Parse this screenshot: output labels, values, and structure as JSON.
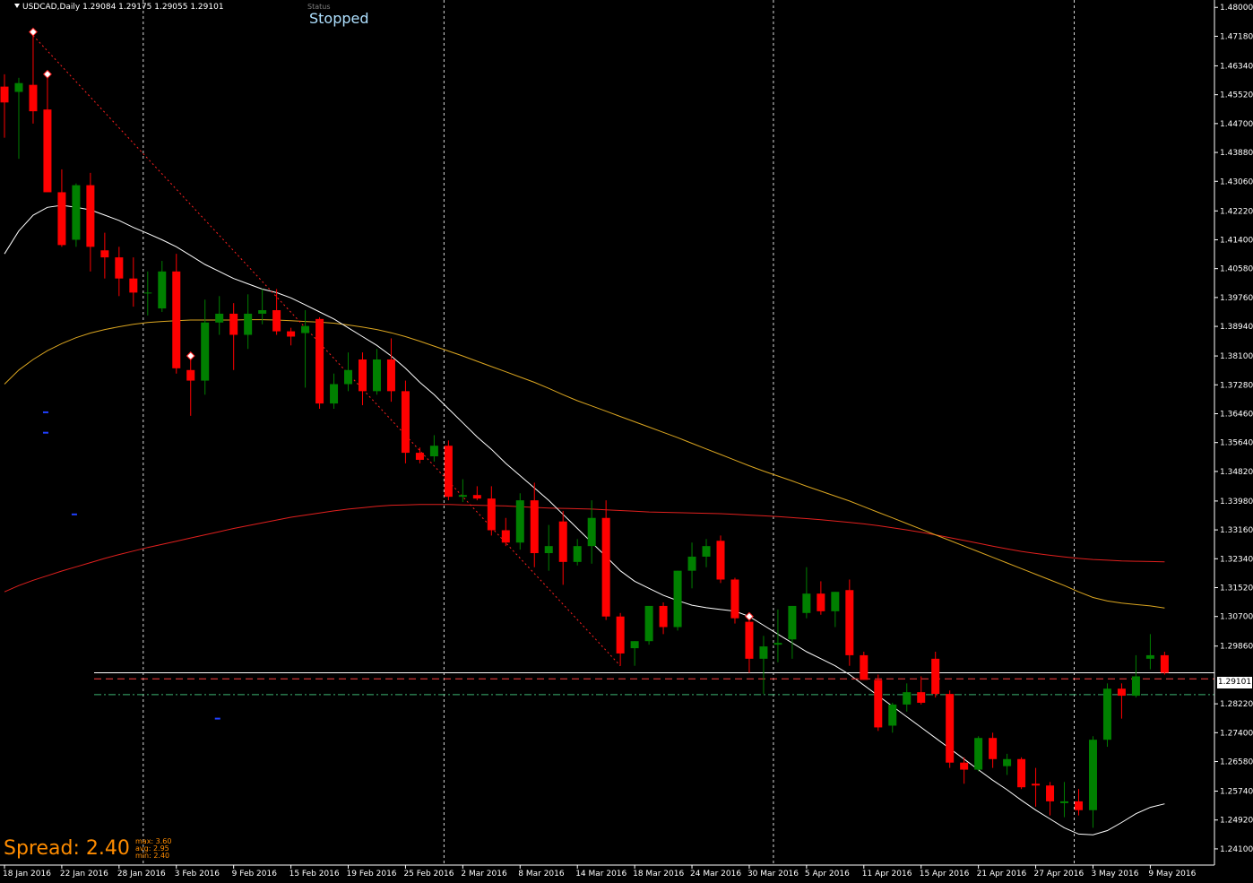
{
  "header": {
    "symbol_info": "USDCAD,Daily  1.29084 1.29175 1.29055 1.29101",
    "status_label": "Status",
    "status_value": "Stopped"
  },
  "spread": {
    "label": "Spread: 2.40",
    "max": "max: 3.60",
    "avg": "avg: 2.95",
    "min": "min: 2.40"
  },
  "colors": {
    "background": "#000000",
    "bull": "#008000",
    "bear": "#ff0000",
    "ma_fast": "#ffffff",
    "ma_mid": "#daa520",
    "ma_slow": "#e0201e",
    "grid": "#ffffff",
    "axis_text": "#ffffff"
  },
  "chart_data": {
    "type": "candlestick",
    "symbol": "USDCAD",
    "timeframe": "Daily",
    "ylim": [
      1.2364,
      1.4821
    ],
    "y_ticks": [
      "1.48000",
      "1.47180",
      "1.46340",
      "1.45520",
      "1.44700",
      "1.43880",
      "1.43060",
      "1.42220",
      "1.41400",
      "1.40580",
      "1.39760",
      "1.38940",
      "1.38100",
      "1.37280",
      "1.36460",
      "1.35640",
      "1.34820",
      "1.33980",
      "1.33160",
      "1.32340",
      "1.31520",
      "1.30700",
      "1.29860",
      "1.28220",
      "1.27400",
      "1.26580",
      "1.25740",
      "1.24920",
      "1.24100"
    ],
    "x_labels": [
      "18 Jan 2016",
      "22 Jan 2016",
      "28 Jan 2016",
      "3 Feb 2016",
      "9 Feb 2016",
      "15 Feb 2016",
      "19 Feb 2016",
      "25 Feb 2016",
      "2 Mar 2016",
      "8 Mar 2016",
      "14 Mar 2016",
      "18 Mar 2016",
      "24 Mar 2016",
      "30 Mar 2016",
      "5 Apr 2016",
      "11 Apr 2016",
      "15 Apr 2016",
      "21 Apr 2016",
      "27 Apr 2016",
      "3 May 2016",
      "9 May 2016"
    ],
    "x_label_index": [
      0,
      4,
      8,
      12,
      16,
      20,
      24,
      28,
      32,
      36,
      40,
      44,
      48,
      52,
      56,
      60,
      64,
      68,
      72,
      76,
      80
    ],
    "period_separators": [
      10,
      31,
      54,
      75
    ],
    "current_price": "1.29101",
    "horizontal_levels": [
      {
        "price": 1.291,
        "style": "solid",
        "color": "#ffffff"
      },
      {
        "price": 1.2893,
        "style": "dashed",
        "color": "#ff4040"
      },
      {
        "price": 1.2848,
        "style": "dashdot",
        "color": "#3cb371"
      }
    ],
    "candles": [
      {
        "o": 1.4575,
        "h": 1.461,
        "l": 1.443,
        "c": 1.453
      },
      {
        "o": 1.456,
        "h": 1.46,
        "l": 1.437,
        "c": 1.4585
      },
      {
        "o": 1.458,
        "h": 1.472,
        "l": 1.447,
        "c": 1.4505
      },
      {
        "o": 1.451,
        "h": 1.46,
        "l": 1.4295,
        "c": 1.4275
      },
      {
        "o": 1.4275,
        "h": 1.434,
        "l": 1.412,
        "c": 1.4125
      },
      {
        "o": 1.414,
        "h": 1.43,
        "l": 1.412,
        "c": 1.4295
      },
      {
        "o": 1.4295,
        "h": 1.433,
        "l": 1.405,
        "c": 1.412
      },
      {
        "o": 1.411,
        "h": 1.416,
        "l": 1.403,
        "c": 1.409
      },
      {
        "o": 1.409,
        "h": 1.412,
        "l": 1.398,
        "c": 1.403
      },
      {
        "o": 1.403,
        "h": 1.409,
        "l": 1.395,
        "c": 1.399
      },
      {
        "o": 1.399,
        "h": 1.405,
        "l": 1.3925,
        "c": 1.399
      },
      {
        "o": 1.3945,
        "h": 1.408,
        "l": 1.3935,
        "c": 1.405
      },
      {
        "o": 1.405,
        "h": 1.41,
        "l": 1.376,
        "c": 1.3775
      },
      {
        "o": 1.377,
        "h": 1.38,
        "l": 1.364,
        "c": 1.374
      },
      {
        "o": 1.374,
        "h": 1.397,
        "l": 1.37,
        "c": 1.3905
      },
      {
        "o": 1.3905,
        "h": 1.398,
        "l": 1.387,
        "c": 1.393
      },
      {
        "o": 1.393,
        "h": 1.396,
        "l": 1.377,
        "c": 1.387
      },
      {
        "o": 1.387,
        "h": 1.3985,
        "l": 1.383,
        "c": 1.393
      },
      {
        "o": 1.393,
        "h": 1.4,
        "l": 1.39,
        "c": 1.394
      },
      {
        "o": 1.394,
        "h": 1.4,
        "l": 1.387,
        "c": 1.388
      },
      {
        "o": 1.388,
        "h": 1.389,
        "l": 1.384,
        "c": 1.3865
      },
      {
        "o": 1.3875,
        "h": 1.394,
        "l": 1.372,
        "c": 1.3895
      },
      {
        "o": 1.3915,
        "h": 1.392,
        "l": 1.366,
        "c": 1.3675
      },
      {
        "o": 1.3675,
        "h": 1.376,
        "l": 1.366,
        "c": 1.373
      },
      {
        "o": 1.373,
        "h": 1.382,
        "l": 1.371,
        "c": 1.377
      },
      {
        "o": 1.38,
        "h": 1.382,
        "l": 1.367,
        "c": 1.371
      },
      {
        "o": 1.371,
        "h": 1.383,
        "l": 1.37,
        "c": 1.38
      },
      {
        "o": 1.38,
        "h": 1.386,
        "l": 1.368,
        "c": 1.371
      },
      {
        "o": 1.371,
        "h": 1.374,
        "l": 1.3505,
        "c": 1.3535
      },
      {
        "o": 1.3535,
        "h": 1.355,
        "l": 1.3505,
        "c": 1.3515
      },
      {
        "o": 1.3525,
        "h": 1.3585,
        "l": 1.351,
        "c": 1.3555
      },
      {
        "o": 1.3555,
        "h": 1.357,
        "l": 1.34,
        "c": 1.341
      },
      {
        "o": 1.341,
        "h": 1.346,
        "l": 1.3395,
        "c": 1.3415
      },
      {
        "o": 1.3415,
        "h": 1.344,
        "l": 1.34,
        "c": 1.3405
      },
      {
        "o": 1.3405,
        "h": 1.344,
        "l": 1.33,
        "c": 1.3315
      },
      {
        "o": 1.3315,
        "h": 1.335,
        "l": 1.327,
        "c": 1.328
      },
      {
        "o": 1.328,
        "h": 1.342,
        "l": 1.326,
        "c": 1.34
      },
      {
        "o": 1.34,
        "h": 1.345,
        "l": 1.321,
        "c": 1.325
      },
      {
        "o": 1.325,
        "h": 1.333,
        "l": 1.32,
        "c": 1.327
      },
      {
        "o": 1.334,
        "h": 1.337,
        "l": 1.316,
        "c": 1.3225
      },
      {
        "o": 1.3225,
        "h": 1.329,
        "l": 1.3215,
        "c": 1.327
      },
      {
        "o": 1.327,
        "h": 1.34,
        "l": 1.322,
        "c": 1.335
      },
      {
        "o": 1.335,
        "h": 1.34,
        "l": 1.306,
        "c": 1.307
      },
      {
        "o": 1.307,
        "h": 1.308,
        "l": 1.293,
        "c": 1.2965
      },
      {
        "o": 1.298,
        "h": 1.3,
        "l": 1.293,
        "c": 1.3
      },
      {
        "o": 1.3,
        "h": 1.31,
        "l": 1.299,
        "c": 1.31
      },
      {
        "o": 1.31,
        "h": 1.311,
        "l": 1.302,
        "c": 1.304
      },
      {
        "o": 1.304,
        "h": 1.32,
        "l": 1.303,
        "c": 1.32
      },
      {
        "o": 1.32,
        "h": 1.328,
        "l": 1.315,
        "c": 1.324
      },
      {
        "o": 1.324,
        "h": 1.329,
        "l": 1.321,
        "c": 1.327
      },
      {
        "o": 1.3285,
        "h": 1.33,
        "l": 1.3165,
        "c": 1.3175
      },
      {
        "o": 1.3175,
        "h": 1.318,
        "l": 1.305,
        "c": 1.3065
      },
      {
        "o": 1.3055,
        "h": 1.306,
        "l": 1.291,
        "c": 1.295
      },
      {
        "o": 1.295,
        "h": 1.3015,
        "l": 1.285,
        "c": 1.2985
      },
      {
        "o": 1.299,
        "h": 1.309,
        "l": 1.294,
        "c": 1.2995
      },
      {
        "o": 1.3005,
        "h": 1.31,
        "l": 1.295,
        "c": 1.31
      },
      {
        "o": 1.308,
        "h": 1.321,
        "l": 1.3065,
        "c": 1.3135
      },
      {
        "o": 1.3135,
        "h": 1.317,
        "l": 1.3075,
        "c": 1.3085
      },
      {
        "o": 1.3085,
        "h": 1.314,
        "l": 1.304,
        "c": 1.314
      },
      {
        "o": 1.3145,
        "h": 1.3175,
        "l": 1.293,
        "c": 1.296
      },
      {
        "o": 1.296,
        "h": 1.297,
        "l": 1.289,
        "c": 1.289
      },
      {
        "o": 1.289,
        "h": 1.2905,
        "l": 1.2745,
        "c": 1.2755
      },
      {
        "o": 1.276,
        "h": 1.2825,
        "l": 1.274,
        "c": 1.282
      },
      {
        "o": 1.282,
        "h": 1.288,
        "l": 1.28,
        "c": 1.2855
      },
      {
        "o": 1.2855,
        "h": 1.29,
        "l": 1.282,
        "c": 1.2825
      },
      {
        "o": 1.295,
        "h": 1.297,
        "l": 1.284,
        "c": 1.285
      },
      {
        "o": 1.285,
        "h": 1.286,
        "l": 1.264,
        "c": 1.2655
      },
      {
        "o": 1.2655,
        "h": 1.267,
        "l": 1.2595,
        "c": 1.2635
      },
      {
        "o": 1.2635,
        "h": 1.273,
        "l": 1.263,
        "c": 1.2725
      },
      {
        "o": 1.2725,
        "h": 1.274,
        "l": 1.264,
        "c": 1.2665
      },
      {
        "o": 1.2645,
        "h": 1.268,
        "l": 1.262,
        "c": 1.2665
      },
      {
        "o": 1.2665,
        "h": 1.267,
        "l": 1.258,
        "c": 1.2585
      },
      {
        "o": 1.2595,
        "h": 1.264,
        "l": 1.253,
        "c": 1.259
      },
      {
        "o": 1.259,
        "h": 1.26,
        "l": 1.2505,
        "c": 1.2545
      },
      {
        "o": 1.254,
        "h": 1.26,
        "l": 1.25,
        "c": 1.2545
      },
      {
        "o": 1.2545,
        "h": 1.258,
        "l": 1.2505,
        "c": 1.252
      },
      {
        "o": 1.252,
        "h": 1.273,
        "l": 1.247,
        "c": 1.272
      },
      {
        "o": 1.272,
        "h": 1.288,
        "l": 1.27,
        "c": 1.2865
      },
      {
        "o": 1.2865,
        "h": 1.288,
        "l": 1.278,
        "c": 1.2845
      },
      {
        "o": 1.2845,
        "h": 1.296,
        "l": 1.284,
        "c": 1.29
      },
      {
        "o": 1.295,
        "h": 1.302,
        "l": 1.292,
        "c": 1.296
      },
      {
        "o": 1.296,
        "h": 1.297,
        "l": 1.2905,
        "c": 1.291
      }
    ],
    "ma_fast": [
      1.41,
      1.4165,
      1.421,
      1.4232,
      1.4238,
      1.4232,
      1.4225,
      1.421,
      1.4195,
      1.4175,
      1.4158,
      1.414,
      1.412,
      1.4095,
      1.407,
      1.405,
      1.403,
      1.4015,
      1.4,
      1.399,
      1.3975,
      1.3955,
      1.3935,
      1.3915,
      1.389,
      1.3865,
      1.384,
      1.381,
      1.3775,
      1.3735,
      1.37,
      1.366,
      1.362,
      1.358,
      1.3545,
      1.3505,
      1.347,
      1.3435,
      1.34,
      1.336,
      1.332,
      1.328,
      1.324,
      1.32,
      1.317,
      1.315,
      1.313,
      1.3115,
      1.3102,
      1.3095,
      1.309,
      1.3085,
      1.307,
      1.3045,
      1.302,
      1.2995,
      1.297,
      1.295,
      1.293,
      1.2905,
      1.2875,
      1.2845,
      1.2815,
      1.2785,
      1.2755,
      1.2725,
      1.2695,
      1.2665,
      1.2635,
      1.2605,
      1.2578,
      1.2548,
      1.252,
      1.2495,
      1.247,
      1.2452,
      1.245,
      1.2462,
      1.2485,
      1.251,
      1.2528,
      1.2538
    ],
    "ma_mid": [
      1.373,
      1.377,
      1.38,
      1.3825,
      1.3845,
      1.3862,
      1.3875,
      1.3885,
      1.3893,
      1.39,
      1.3905,
      1.3908,
      1.391,
      1.3912,
      1.3912,
      1.3912,
      1.3912,
      1.3913,
      1.3913,
      1.3912,
      1.391,
      1.3908,
      1.3906,
      1.3903,
      1.3898,
      1.3892,
      1.3885,
      1.3876,
      1.3865,
      1.3852,
      1.3838,
      1.3824,
      1.381,
      1.3795,
      1.378,
      1.3765,
      1.375,
      1.3735,
      1.3718,
      1.37,
      1.3683,
      1.3668,
      1.3653,
      1.3638,
      1.3623,
      1.3608,
      1.3593,
      1.3578,
      1.3562,
      1.3546,
      1.353,
      1.3514,
      1.3498,
      1.3483,
      1.3469,
      1.3455,
      1.344,
      1.3426,
      1.3412,
      1.3398,
      1.3382,
      1.3366,
      1.335,
      1.3334,
      1.3318,
      1.3302,
      1.3286,
      1.327,
      1.3254,
      1.3238,
      1.3222,
      1.3206,
      1.319,
      1.3174,
      1.3158,
      1.314,
      1.3124,
      1.3114,
      1.3108,
      1.3104,
      1.31,
      1.3094
    ],
    "ma_slow": [
      1.314,
      1.3158,
      1.3173,
      1.3186,
      1.3199,
      1.3211,
      1.3223,
      1.3235,
      1.3246,
      1.3256,
      1.3266,
      1.3275,
      1.3284,
      1.3293,
      1.3302,
      1.3311,
      1.332,
      1.3328,
      1.3336,
      1.3344,
      1.3352,
      1.3358,
      1.3364,
      1.337,
      1.3375,
      1.3379,
      1.3383,
      1.3386,
      1.3387,
      1.3388,
      1.3388,
      1.3388,
      1.3387,
      1.3386,
      1.3385,
      1.3384,
      1.3382,
      1.338,
      1.3378,
      1.3377,
      1.3376,
      1.3375,
      1.3373,
      1.3371,
      1.3369,
      1.3367,
      1.3366,
      1.3365,
      1.3364,
      1.3363,
      1.3362,
      1.336,
      1.3358,
      1.3356,
      1.3354,
      1.3351,
      1.3348,
      1.3345,
      1.3341,
      1.3337,
      1.3333,
      1.3328,
      1.3322,
      1.3316,
      1.3309,
      1.3302,
      1.3294,
      1.3286,
      1.3278,
      1.327,
      1.3262,
      1.3255,
      1.3249,
      1.3244,
      1.3239,
      1.3235,
      1.3232,
      1.323,
      1.3228,
      1.3227,
      1.3226,
      1.3225
    ],
    "fractals_up": [
      2,
      3,
      13,
      52
    ],
    "blue_marks": [
      {
        "idx": 1,
        "price": 1.365
      },
      {
        "idx": 1,
        "price": 1.3592
      },
      {
        "idx": 3,
        "price": 1.336
      },
      {
        "idx": 13,
        "price": 1.278
      }
    ]
  }
}
